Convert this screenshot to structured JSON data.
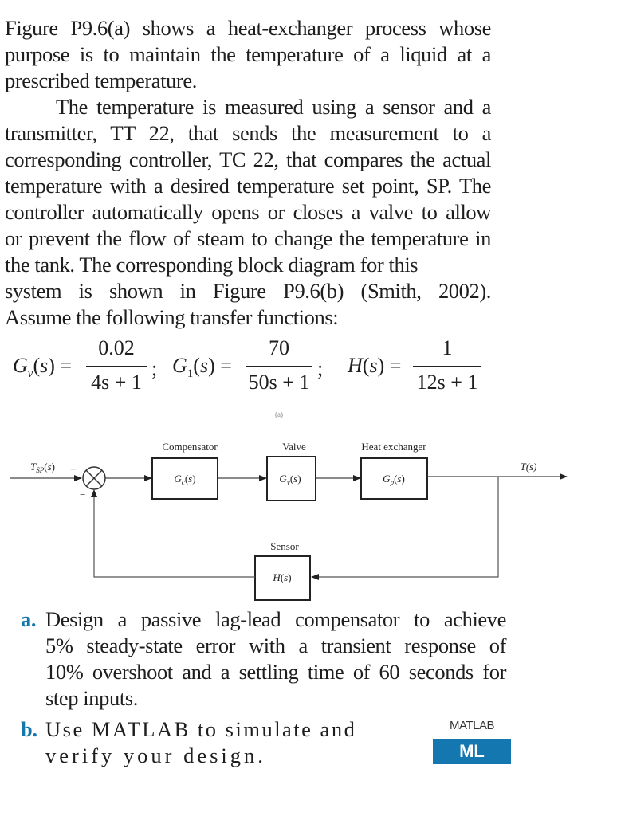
{
  "intro": {
    "paragraph1": [
      "Figure P9.6(a) shows a heat-exchanger process whose",
      "purpose is to maintain the temperature of a liquid at a",
      "prescribed temperature."
    ],
    "paragraph2": [
      "The temperature is measured using a sensor and a",
      "transmitter, TT 22, that sends the measurement to a",
      "corresponding controller, TC 22, that compares the actual",
      "temperature with a desired temperature set point, SP. The",
      "controller automatically opens or closes a valve to allow",
      "or prevent the flow of steam to change the temperature in",
      "the tank. The corresponding block diagram for this",
      "system is shown in Figure P9.6(b) (Smith, 2002).",
      "Assume the following transfer functions:"
    ]
  },
  "equations": [
    {
      "lhs": "Gv(s) =",
      "lhs_main": "G",
      "lhs_sub": "v",
      "numerator": "0.02",
      "denominator": "4s + 1",
      "sep": ";"
    },
    {
      "lhs": "G1(s) =",
      "lhs_main": "G",
      "lhs_sub": "1",
      "numerator": "70",
      "denominator": "50s + 1",
      "sep": ";"
    },
    {
      "lhs": "H(s) =",
      "lhs_main": "H",
      "lhs_sub": "",
      "numerator": "1",
      "denominator": "12s + 1",
      "sep": ""
    }
  ],
  "caption_remnant": "(a)",
  "diagram": {
    "input_label": "T_SP(s)",
    "input_main": "T",
    "input_sub": "SP",
    "plus_sign": "+",
    "minus_sign": "−",
    "output_label": "T(s)",
    "blocks": [
      {
        "title": "Compensator",
        "tf": "Gc(s)",
        "tf_main": "G",
        "tf_sub": "c"
      },
      {
        "title": "Valve",
        "tf": "Gv(s)",
        "tf_main": "G",
        "tf_sub": "v"
      },
      {
        "title": "Heat exchanger",
        "tf": "Gp(s)",
        "tf_main": "G",
        "tf_sub": "p"
      },
      {
        "title": "Sensor",
        "tf": "H(s)",
        "tf_main": "H",
        "tf_sub": ""
      }
    ]
  },
  "questions": [
    {
      "marker": "a.",
      "lines": [
        "Design a passive lag-lead compensator to achieve",
        "5% steady-state error with a transient response of",
        "10% overshoot and a settling time of 60 seconds for",
        "step inputs."
      ]
    },
    {
      "marker": "b.",
      "lines": [
        "Use MATLAB to simulate and",
        "verify your design."
      ]
    }
  ],
  "matlab_badge": {
    "caption": "MATLAB",
    "label": "ML",
    "color": "#1577b0"
  },
  "colors": {
    "question_marker": "#1576ad",
    "text": "#1e1e1e"
  }
}
